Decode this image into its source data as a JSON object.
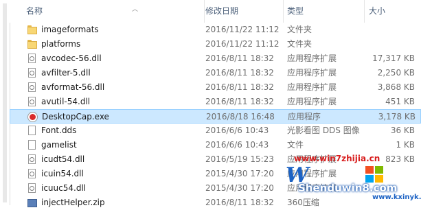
{
  "columns": {
    "name": "名称",
    "date": "修改日期",
    "type": "类型",
    "size": "大小"
  },
  "files": [
    {
      "name": "imageformats",
      "date": "2016/11/22 11:12",
      "type": "文件夹",
      "size": "",
      "icon": "folder-icon",
      "selected": false
    },
    {
      "name": "platforms",
      "date": "2016/11/22 11:12",
      "type": "文件夹",
      "size": "",
      "icon": "folder-icon",
      "selected": false
    },
    {
      "name": "avcodec-56.dll",
      "date": "2016/8/11 18:32",
      "type": "应用程序扩展",
      "size": "17,317 KB",
      "icon": "dll-icon",
      "selected": false
    },
    {
      "name": "avfilter-5.dll",
      "date": "2016/8/11 18:32",
      "type": "应用程序扩展",
      "size": "2,250 KB",
      "icon": "dll-icon",
      "selected": false
    },
    {
      "name": "avformat-56.dll",
      "date": "2016/8/11 18:32",
      "type": "应用程序扩展",
      "size": "3,868 KB",
      "icon": "dll-icon",
      "selected": false
    },
    {
      "name": "avutil-54.dll",
      "date": "2016/8/11 18:32",
      "type": "应用程序扩展",
      "size": "451 KB",
      "icon": "dll-icon",
      "selected": false
    },
    {
      "name": "DesktopCap.exe",
      "date": "2016/8/18 16:48",
      "type": "应用程序",
      "size": "3,178 KB",
      "icon": "exe-icon",
      "selected": true
    },
    {
      "name": "Font.dds",
      "date": "2016/6/6 10:43",
      "type": "光影看图 DDS 图像",
      "size": "36 KB",
      "icon": "file-icon",
      "selected": false
    },
    {
      "name": "gamelist",
      "date": "2016/6/6 10:43",
      "type": "文件",
      "size": "1 KB",
      "icon": "file-icon",
      "selected": false
    },
    {
      "name": "icudt54.dll",
      "date": "2016/5/19 15:23",
      "type": "应用程序扩展",
      "size": "823 KB",
      "icon": "dll-icon",
      "selected": false
    },
    {
      "name": "icuin54.dll",
      "date": "2015/4/30 17:20",
      "type": "应用程序扩展",
      "size": "",
      "icon": "dll-icon",
      "selected": false
    },
    {
      "name": "icuuc54.dll",
      "date": "2015/4/30 17:20",
      "type": "应用程序扩展",
      "size": "",
      "icon": "dll-icon",
      "selected": false
    },
    {
      "name": "injectHelper.zip",
      "date": "2016/8/11 18:32",
      "type": "360压缩",
      "size": "",
      "icon": "zip-icon",
      "selected": false
    }
  ],
  "watermark": {
    "url_top": "www.win7zhijia.cn",
    "logo_text": "W",
    "brand": "Shenduwin8.com",
    "url_bottom": "www.kxinyk.com"
  }
}
